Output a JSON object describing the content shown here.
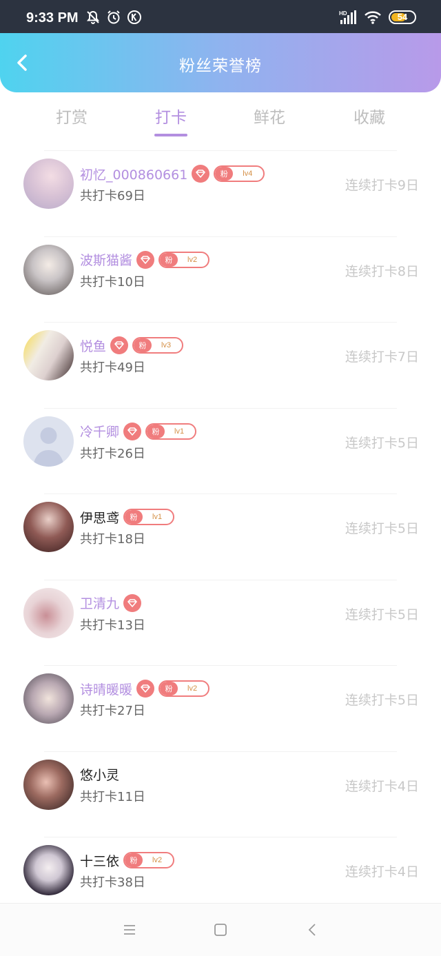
{
  "status_bar": {
    "time": "9:33 PM",
    "battery": "54",
    "network": "HD"
  },
  "header": {
    "title": "粉丝荣誉榜"
  },
  "tabs": [
    {
      "label": "打赏",
      "active": false
    },
    {
      "label": "打卡",
      "active": true
    },
    {
      "label": "鲜花",
      "active": false
    },
    {
      "label": "收藏",
      "active": false
    }
  ],
  "fans": [
    {
      "name": "初忆_000860661",
      "total": "共打卡69日",
      "streak": "连续打卡9日",
      "gem": true,
      "fen": "粉",
      "level": "lv4",
      "vip": true
    },
    {
      "name": "波斯猫酱",
      "total": "共打卡10日",
      "streak": "连续打卡8日",
      "gem": true,
      "fen": "粉",
      "level": "lv2",
      "vip": true
    },
    {
      "name": "悦鱼",
      "total": "共打卡49日",
      "streak": "连续打卡7日",
      "gem": true,
      "fen": "粉",
      "level": "lv3",
      "vip": true
    },
    {
      "name": "冷千卿",
      "total": "共打卡26日",
      "streak": "连续打卡5日",
      "gem": true,
      "fen": "粉",
      "level": "lv1",
      "vip": true
    },
    {
      "name": "伊思鸢",
      "total": "共打卡18日",
      "streak": "连续打卡5日",
      "gem": false,
      "fen": "粉",
      "level": "lv1",
      "vip": false
    },
    {
      "name": "卫清九",
      "total": "共打卡13日",
      "streak": "连续打卡5日",
      "gem": true,
      "fen": "",
      "level": "",
      "vip": true
    },
    {
      "name": "诗晴暖暖",
      "total": "共打卡27日",
      "streak": "连续打卡5日",
      "gem": true,
      "fen": "粉",
      "level": "lv2",
      "vip": true
    },
    {
      "name": "悠小灵",
      "total": "共打卡11日",
      "streak": "连续打卡4日",
      "gem": false,
      "fen": "",
      "level": "",
      "vip": false
    },
    {
      "name": "十三依",
      "total": "共打卡38日",
      "streak": "连续打卡4日",
      "gem": false,
      "fen": "粉",
      "level": "lv2",
      "vip": false
    }
  ],
  "colors": {
    "accent": "#b38fe0",
    "badge": "#f07c7d",
    "header_start": "#4fd3ef",
    "header_end": "#b89ae9"
  }
}
